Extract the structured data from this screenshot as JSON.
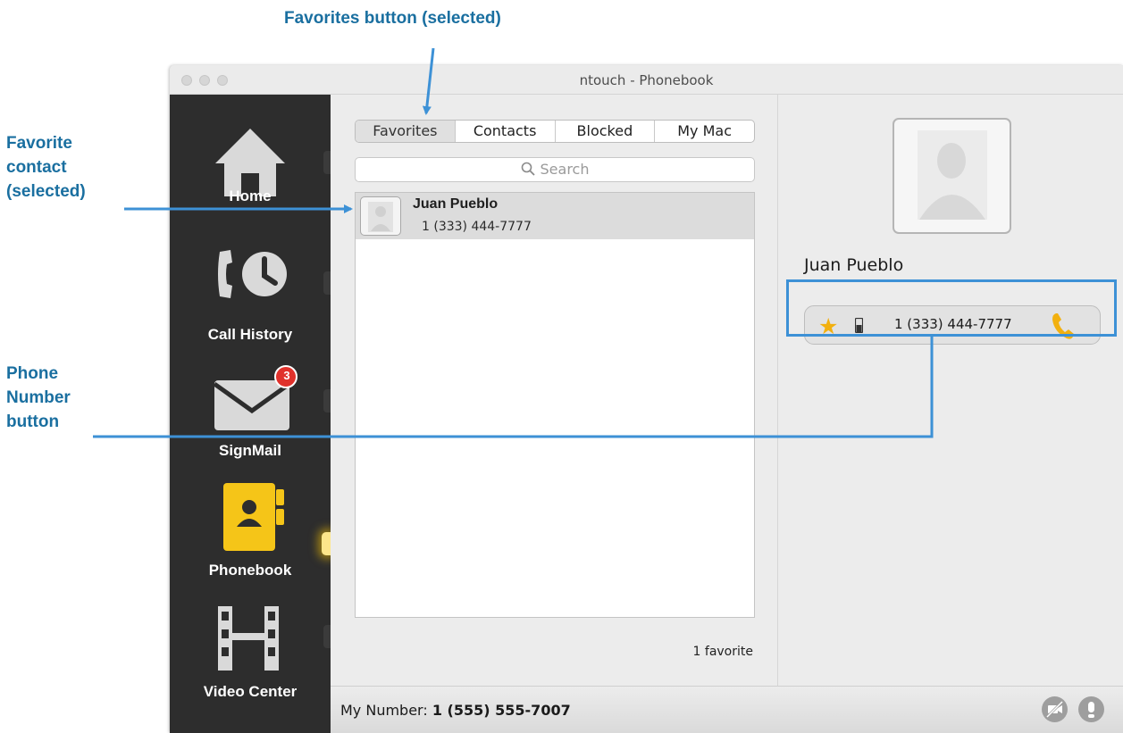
{
  "callouts": {
    "favorites_button": "Favorites button (selected)",
    "favorite_contact": [
      "Favorite",
      "contact",
      "(selected)"
    ],
    "phone_number_button": [
      "Phone",
      "Number",
      "button"
    ]
  },
  "window": {
    "title": "ntouch - Phonebook"
  },
  "sidebar": {
    "items": [
      {
        "label": "Home",
        "icon": "home-icon"
      },
      {
        "label": "Call History",
        "icon": "call-history-icon"
      },
      {
        "label": "SignMail",
        "icon": "signmail-icon",
        "badge": "3"
      },
      {
        "label": "Phonebook",
        "icon": "phonebook-icon",
        "active": true
      },
      {
        "label": "Video Center",
        "icon": "video-center-icon"
      }
    ]
  },
  "phonebook": {
    "tabs": [
      "Favorites",
      "Contacts",
      "Blocked",
      "My Mac"
    ],
    "selected_tab": "Favorites",
    "search_placeholder": "Search",
    "contacts": [
      {
        "name": "Juan Pueblo",
        "number": "1 (333) 444-7777"
      }
    ],
    "count_label": "1 favorite"
  },
  "detail": {
    "name": "Juan Pueblo",
    "phone": {
      "number": "1 (333) 444-7777",
      "favorite": true,
      "type": "mobile"
    }
  },
  "bottom": {
    "my_number_label": "My Number:",
    "my_number": "1 (555) 555-7007"
  },
  "colors": {
    "accent": "#f2b00f",
    "callout": "#1a6fa0",
    "callout_line": "#3d91d6",
    "badge": "#e0312b"
  }
}
